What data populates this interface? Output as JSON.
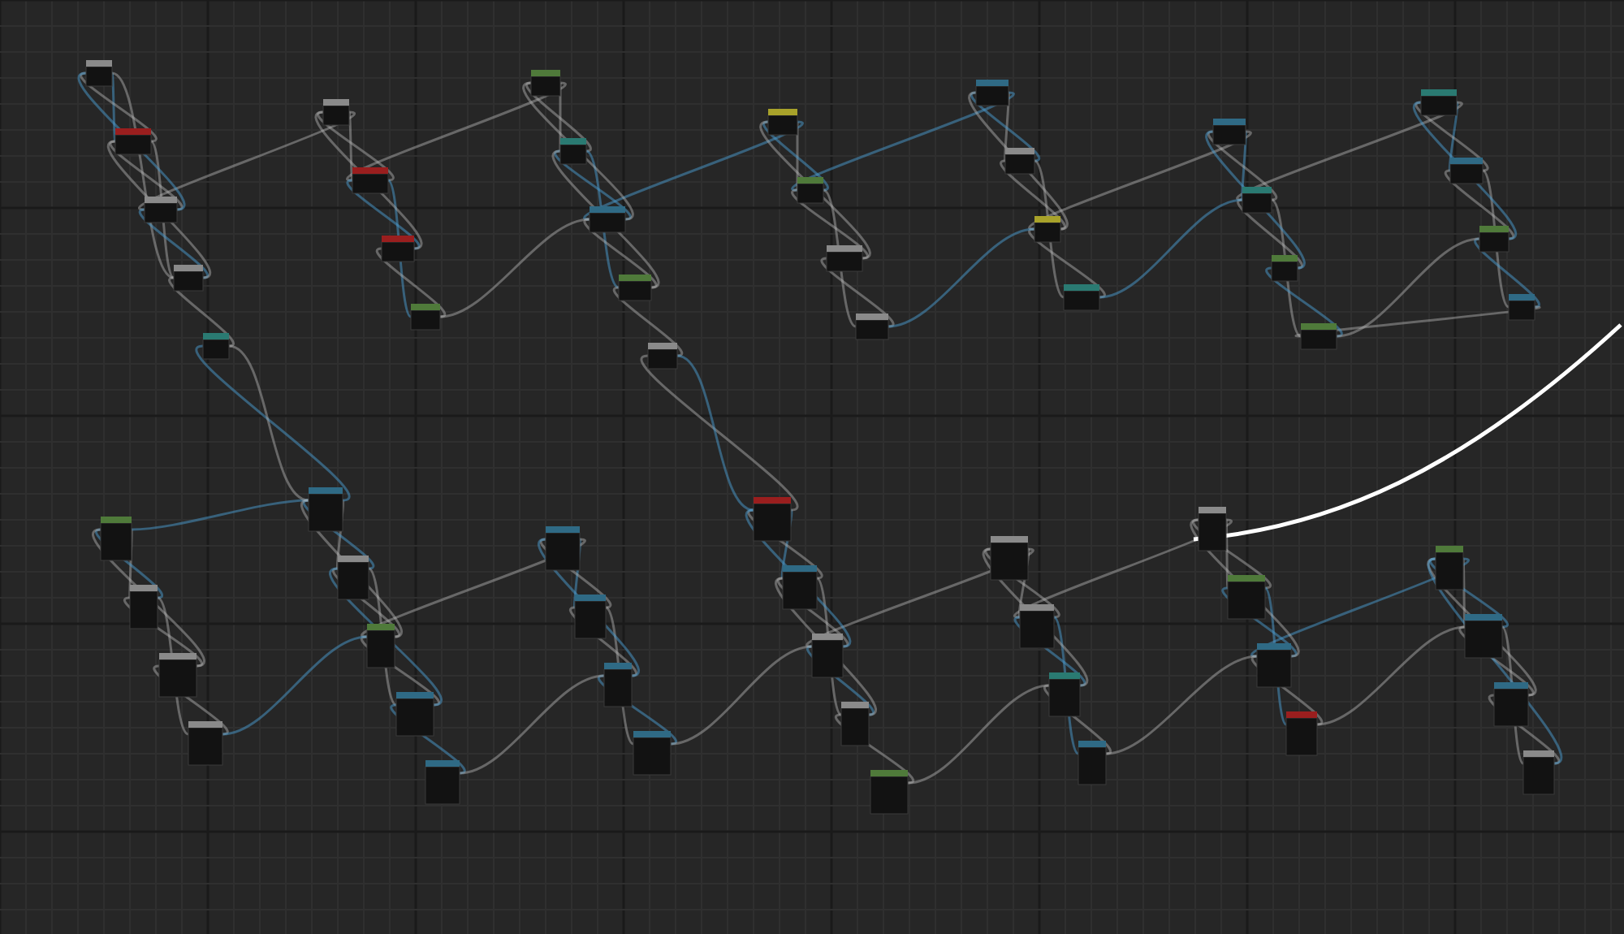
{
  "graph": {
    "nodes": [
      {
        "color": "#8a8a8a"
      },
      {
        "color": "#2f6a85"
      },
      {
        "color": "#4f7a3a"
      },
      {
        "color": "#9a1e1e"
      },
      {
        "color": "#2f6a85"
      },
      {
        "color": "#8a8a8a"
      },
      {
        "color": "#2a7a72"
      },
      {
        "color": "#4f7a3a"
      },
      {
        "color": "#8a8a8a"
      },
      {
        "color": "#2f6a85"
      },
      {
        "color": "#a8a22a"
      },
      {
        "color": "#8a8a8a"
      },
      {
        "color": "#2f6a85"
      },
      {
        "color": "#4f7a3a"
      },
      {
        "color": "#9a1e1e"
      },
      {
        "color": "#8a8a8a"
      },
      {
        "color": "#2a7a72"
      },
      {
        "color": "#2f6a85"
      },
      {
        "color": "#8a8a8a"
      },
      {
        "color": "#4f7a3a"
      },
      {
        "color": "#2f6a85"
      },
      {
        "color": "#8a8a8a"
      },
      {
        "color": "#9a1e1e"
      },
      {
        "color": "#2f6a85"
      },
      {
        "color": "#4f7a3a"
      },
      {
        "color": "#8a8a8a"
      },
      {
        "color": "#2a7a72"
      },
      {
        "color": "#2f6a85"
      },
      {
        "color": "#8a8a8a"
      },
      {
        "color": "#4f7a3a"
      },
      {
        "color": "#2f6a85"
      },
      {
        "color": "#8a8a8a"
      },
      {
        "color": "#a8a22a"
      },
      {
        "color": "#2f6a85"
      },
      {
        "color": "#4f7a3a"
      },
      {
        "color": "#8a8a8a"
      },
      {
        "color": "#9a1e1e"
      },
      {
        "color": "#2f6a85"
      },
      {
        "color": "#8a8a8a"
      },
      {
        "color": "#2a7a72"
      },
      {
        "color": "#4f7a3a"
      },
      {
        "color": "#2f6a85"
      },
      {
        "color": "#8a8a8a"
      },
      {
        "color": "#2f6a85"
      },
      {
        "color": "#4f7a3a"
      },
      {
        "color": "#8a8a8a"
      },
      {
        "color": "#2a7a72"
      },
      {
        "color": "#9a1e1e"
      },
      {
        "color": "#2f6a85"
      },
      {
        "color": "#8a8a8a"
      },
      {
        "color": "#4f7a3a"
      },
      {
        "color": "#2f6a85"
      },
      {
        "color": "#8a8a8a"
      },
      {
        "color": "#2f6a85"
      },
      {
        "color": "#4f7a3a"
      },
      {
        "color": "#8a8a8a"
      },
      {
        "color": "#2a7a72"
      },
      {
        "color": "#2f6a85"
      },
      {
        "color": "#8a8a8a"
      },
      {
        "color": "#4f7a3a"
      }
    ]
  }
}
